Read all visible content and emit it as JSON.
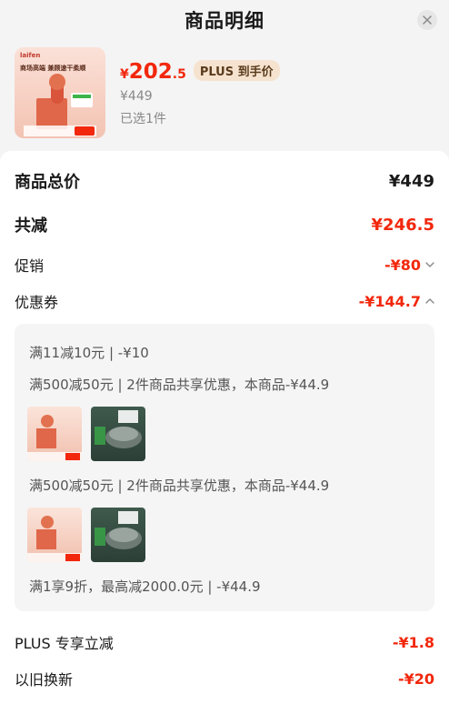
{
  "header": {
    "title": "商品明细"
  },
  "product": {
    "brand_text": "laifen",
    "promo_text": "商场高端 兼顾速干柔顺",
    "price_symbol": "¥",
    "price_int": "202",
    "price_dec": ".5",
    "plus_badge": "PLUS 到手价",
    "original_price": "¥449",
    "selected": "已选1件"
  },
  "summary": {
    "total_label": "商品总价",
    "total_value": "¥449",
    "discount_label": "共减",
    "discount_value": "¥246.5",
    "promo_label": "促销",
    "promo_value": "-¥80",
    "coupon_label": "优惠券",
    "coupon_value": "-¥144.7"
  },
  "coupons": {
    "line1": "满11减10元 | -¥10",
    "line2": "满500减50元 | 2件商品共享优惠，本商品-¥44.9",
    "line3": "满500减50元 | 2件商品共享优惠，本商品-¥44.9",
    "line4": "满1享9折，最高减2000.0元 | -¥44.9"
  },
  "extras": {
    "plus_label": "PLUS 专享立减",
    "plus_value": "-¥1.8",
    "tradein_label": "以旧换新",
    "tradein_value": "-¥20"
  },
  "colors": {
    "accent_red": "#f2270c",
    "plus_gold": "#f6e3cf"
  },
  "icons": {
    "close": "close-icon",
    "chevron_down": "chevron-down-icon",
    "chevron_up": "chevron-up-icon"
  }
}
